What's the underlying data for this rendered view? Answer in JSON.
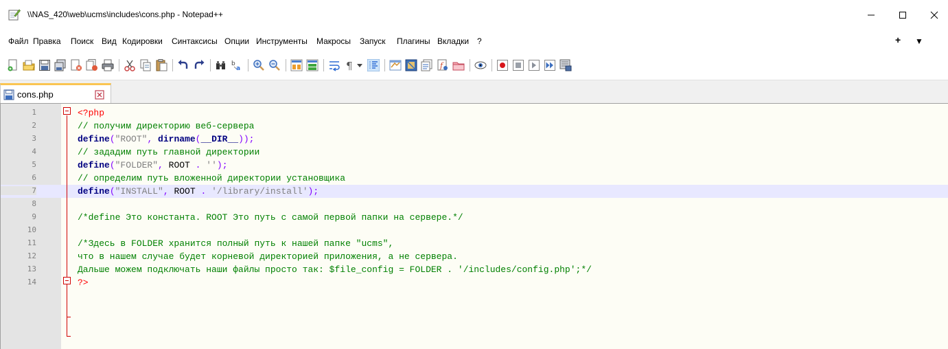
{
  "window": {
    "title": "\\\\NAS_420\\web\\ucms\\includes\\cons.php - Notepad++",
    "minimize_label": "minimize",
    "maximize_label": "maximize",
    "close_label": "close"
  },
  "menu": {
    "items": [
      "Файл",
      "Правка",
      "Поиск",
      "Вид",
      "Кодировки",
      "Синтаксисы",
      "Опции",
      "Инструменты",
      "Макросы",
      "Запуск",
      "Плагины",
      "Вкладки",
      "?"
    ],
    "plus": "+",
    "dropdown": "▼"
  },
  "toolbar": {
    "icons": [
      "new-file-icon",
      "open-file-icon",
      "save-icon",
      "save-all-icon",
      "close-icon",
      "close-all-icon",
      "print-icon",
      "cut-icon",
      "copy-icon",
      "paste-icon",
      "undo-icon",
      "redo-icon",
      "find-icon",
      "replace-icon",
      "zoom-in-icon",
      "zoom-out-icon",
      "sync-vertical-icon",
      "sync-horizontal-icon",
      "word-wrap-icon",
      "show-all-chars-icon",
      "indent-guide-icon",
      "user-lang-icon",
      "doc-map-icon",
      "function-list-icon",
      "folder-workspace-icon",
      "monitoring-icon",
      "record-macro-icon",
      "stop-record-icon",
      "play-macro-icon",
      "run-macro-multiple-icon",
      "save-macro-icon"
    ]
  },
  "tabs": [
    {
      "label": "cons.php",
      "active": true
    }
  ],
  "editor": {
    "lines": [
      {
        "num": "1",
        "tokens": [
          {
            "t": "<?php",
            "c": "t-php"
          }
        ]
      },
      {
        "num": "2",
        "tokens": [
          {
            "t": "// получим директорию веб-сервера",
            "c": "t-comment"
          }
        ]
      },
      {
        "num": "3",
        "tokens": [
          {
            "t": "define",
            "c": "t-func"
          },
          {
            "t": "(",
            "c": "t-op"
          },
          {
            "t": "\"ROOT\"",
            "c": "t-str"
          },
          {
            "t": ", ",
            "c": "t-op"
          },
          {
            "t": "dirname",
            "c": "t-func"
          },
          {
            "t": "(",
            "c": "t-op"
          },
          {
            "t": "__DIR__",
            "c": "t-dir"
          },
          {
            "t": "));",
            "c": "t-op"
          }
        ]
      },
      {
        "num": "4",
        "tokens": [
          {
            "t": "// зададим путь главной директории",
            "c": "t-comment"
          }
        ]
      },
      {
        "num": "5",
        "tokens": [
          {
            "t": "define",
            "c": "t-func"
          },
          {
            "t": "(",
            "c": "t-op"
          },
          {
            "t": "\"FOLDER\"",
            "c": "t-str"
          },
          {
            "t": ", ",
            "c": "t-op"
          },
          {
            "t": "ROOT",
            "c": "t-const"
          },
          {
            "t": " . ",
            "c": "t-op"
          },
          {
            "t": "''",
            "c": "t-str"
          },
          {
            "t": ");",
            "c": "t-op"
          }
        ]
      },
      {
        "num": "6",
        "tokens": [
          {
            "t": "// определим путь вложенной директории установщика",
            "c": "t-comment"
          }
        ]
      },
      {
        "num": "7",
        "tokens": [
          {
            "t": "define",
            "c": "t-func"
          },
          {
            "t": "(",
            "c": "t-op"
          },
          {
            "t": "\"INSTALL\"",
            "c": "t-str"
          },
          {
            "t": ", ",
            "c": "t-op"
          },
          {
            "t": "ROOT",
            "c": "t-const"
          },
          {
            "t": " . ",
            "c": "t-op"
          },
          {
            "t": "'/library/install'",
            "c": "t-str"
          },
          {
            "t": ");",
            "c": "t-op"
          }
        ]
      },
      {
        "num": "8",
        "tokens": []
      },
      {
        "num": "9",
        "tokens": [
          {
            "t": "/*define Это константа. ROOT Это путь с самой первой папки на сервере.*/",
            "c": "t-comment"
          }
        ]
      },
      {
        "num": "10",
        "tokens": []
      },
      {
        "num": "11",
        "tokens": [
          {
            "t": "/*Здесь в FOLDER хранится полный путь к нашей папке \"ucms\",",
            "c": "t-comment"
          }
        ]
      },
      {
        "num": "12",
        "tokens": [
          {
            "t": "что в нашем случае будет корневой директорией приложения, а не сервера.",
            "c": "t-comment"
          }
        ]
      },
      {
        "num": "13",
        "tokens": [
          {
            "t": "Дальше можем подключать наши файлы просто так: $file_config = FOLDER . '/includes/config.php';*/",
            "c": "t-comment"
          }
        ]
      },
      {
        "num": "14",
        "tokens": [
          {
            "t": "?>",
            "c": "t-php"
          }
        ]
      }
    ],
    "current_line": "7"
  }
}
